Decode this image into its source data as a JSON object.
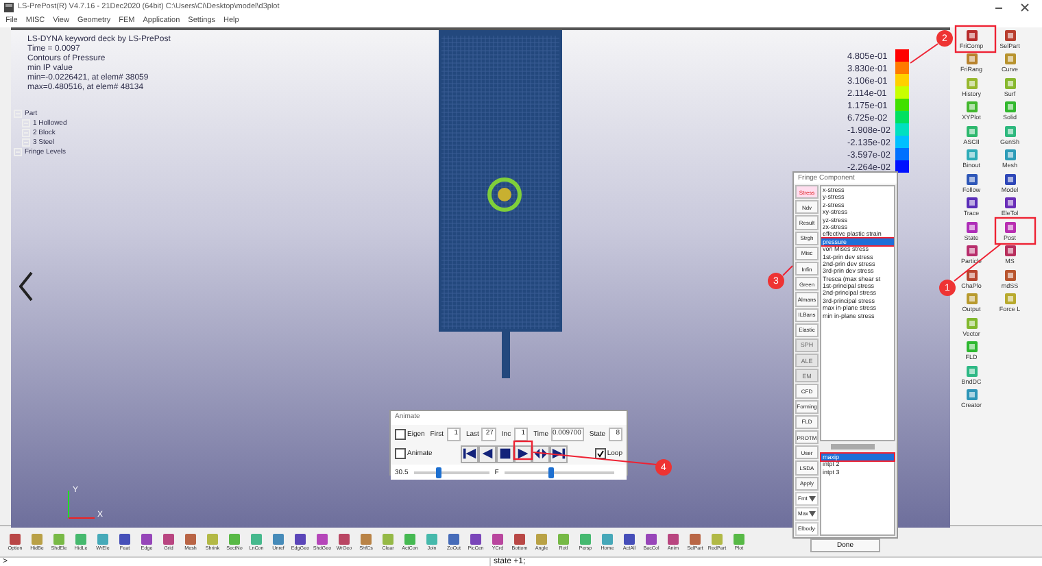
{
  "window": {
    "title": "LS-PrePost(R) V4.7.16 - 21Dec2020 (64bit) C:\\Users\\Ci\\Desktop\\model\\d3plot"
  },
  "menu": [
    "File",
    "MISC",
    "View",
    "Geometry",
    "FEM",
    "Application",
    "Settings",
    "Help"
  ],
  "viewport": {
    "info_lines": [
      "LS-DYNA keyword deck by LS-PrePost",
      "Time = 0.0097",
      "Contours of Pressure",
      "min IP value",
      "min=-0.0226421, at elem# 38059",
      "max=0.480516, at elem# 48134"
    ],
    "tree": [
      {
        "label": "Part",
        "children": [
          {
            "label": "1 Hollowed"
          },
          {
            "label": "2 Block"
          },
          {
            "label": "3 Steel"
          }
        ]
      },
      {
        "label": "Fringe Levels"
      }
    ],
    "axes": [
      "Y",
      "X"
    ],
    "legend": [
      "4.805e-01",
      "3.830e-01",
      "3.106e-01",
      "2.114e-01",
      "1.175e-01",
      "6.725e-02",
      "-1.908e-02",
      "-2.135e-02",
      "-3.597e-02",
      "-2.264e-02"
    ]
  },
  "right_toolbar": [
    [
      "FriComp",
      "FriRang",
      "History",
      "XYPlot",
      "ASCII",
      "Binout",
      "Follow",
      "Trace",
      "State",
      "Particle",
      "ChaPlo",
      "Output",
      "Vector",
      "FLD",
      "BndDC",
      "Creator"
    ],
    [
      "SelPart",
      "Curve",
      "Surf",
      "Solid",
      "GenSh",
      "Mesh",
      "Model",
      "EleTol",
      "Post",
      "MS",
      "mdSS",
      "Force L"
    ]
  ],
  "fringe_dialog": {
    "title": "Fringe Component",
    "categories": [
      {
        "label": "Stress",
        "selected": true,
        "disabled": false
      },
      {
        "label": "Ndv",
        "selected": false,
        "disabled": false
      },
      {
        "label": "Result",
        "selected": false,
        "disabled": false
      },
      {
        "label": "Strgh",
        "selected": false,
        "disabled": false
      },
      {
        "label": "Misc",
        "selected": false,
        "disabled": false
      },
      {
        "label": "Infin",
        "selected": false,
        "disabled": false
      },
      {
        "label": "Green",
        "selected": false,
        "disabled": false
      },
      {
        "label": "Almans",
        "selected": false,
        "disabled": false
      },
      {
        "label": "ILBans",
        "selected": false,
        "disabled": false
      },
      {
        "label": "Elastic",
        "selected": false,
        "disabled": false
      },
      {
        "label": "SPH",
        "selected": false,
        "disabled": true
      },
      {
        "label": "ALE",
        "selected": false,
        "disabled": true
      },
      {
        "label": "EM",
        "selected": false,
        "disabled": true
      },
      {
        "label": "CFD",
        "selected": false,
        "disabled": false
      },
      {
        "label": "Forming",
        "selected": false,
        "disabled": false
      },
      {
        "label": "FLD",
        "selected": false,
        "disabled": false
      },
      {
        "label": "PROTM",
        "selected": false,
        "disabled": false
      },
      {
        "label": "User",
        "selected": false,
        "disabled": false
      },
      {
        "label": "LSDA",
        "selected": false,
        "disabled": false
      }
    ],
    "components": [
      {
        "label": "x-stress",
        "selected": false
      },
      {
        "label": "y-stress",
        "selected": false
      },
      {
        "label": "z-stress",
        "selected": false
      },
      {
        "label": "xy-stress",
        "selected": false
      },
      {
        "label": "yz-stress",
        "selected": false
      },
      {
        "label": "zx-stress",
        "selected": false
      },
      {
        "label": "effective plastic strain",
        "selected": false
      },
      {
        "label": "pressure",
        "selected": true
      },
      {
        "label": "von Mises stress",
        "selected": false
      },
      {
        "label": "1st-prin dev stress",
        "selected": false
      },
      {
        "label": "2nd-prin dev stress",
        "selected": false
      },
      {
        "label": "3rd-prin dev stress",
        "selected": false
      },
      {
        "label": "Tresca (max shear st",
        "selected": false
      },
      {
        "label": "1st-principal stress",
        "selected": false
      },
      {
        "label": "2nd-principal stress",
        "selected": false
      },
      {
        "label": "3rd-principal stress",
        "selected": false
      },
      {
        "label": "max in-plane stress",
        "selected": false
      },
      {
        "label": "min in-plane stress",
        "selected": false
      }
    ],
    "apply": "Apply",
    "selects": [
      "Fmt",
      "Max",
      "Elbody"
    ],
    "points": [
      {
        "label": "maxip",
        "selected": true
      },
      {
        "label": "intpt 2",
        "selected": false
      },
      {
        "label": "intpt 3",
        "selected": false
      }
    ],
    "done": "Done"
  },
  "animate_dialog": {
    "title": "Animate",
    "eigen": {
      "label": "Eigen",
      "checked": false
    },
    "fields": [
      {
        "label": "First",
        "value": "1"
      },
      {
        "label": "Last",
        "value": "27"
      },
      {
        "label": "Inc",
        "value": "1"
      },
      {
        "label": "Time",
        "value": "0.009700"
      },
      {
        "label": "State",
        "value": "8"
      }
    ],
    "animate": {
      "label": "Animate",
      "checked": false
    },
    "loop": {
      "label": "Loop",
      "checked": true
    },
    "speed": {
      "reading": "30.5",
      "level": 0.33
    },
    "frame": {
      "label": "F",
      "level": 0.43
    }
  },
  "bottom_toolbar": [
    "Option",
    "HidBe",
    "ShdEle",
    "HidLe",
    "WrEle",
    "Feat",
    "Edge",
    "Grid",
    "Mesh",
    "Shrink",
    "SectNo",
    "LnCon",
    "Unref",
    "EdgGeo",
    "ShdGeo",
    "WrGeo",
    "ShfCs",
    "Clear",
    "ActCon",
    "Join",
    "ZoOut",
    "PicCen",
    "YCrd",
    "Bottom",
    "Angle",
    "Rotl",
    "Persp",
    "Home",
    "ActAll",
    "BacCol",
    "Anim",
    "SelPart",
    "RedPart",
    "Plot"
  ],
  "command": {
    "prompt": ">",
    "history": "state +1;"
  },
  "annotations": [
    "1",
    "2",
    "3",
    "4"
  ]
}
